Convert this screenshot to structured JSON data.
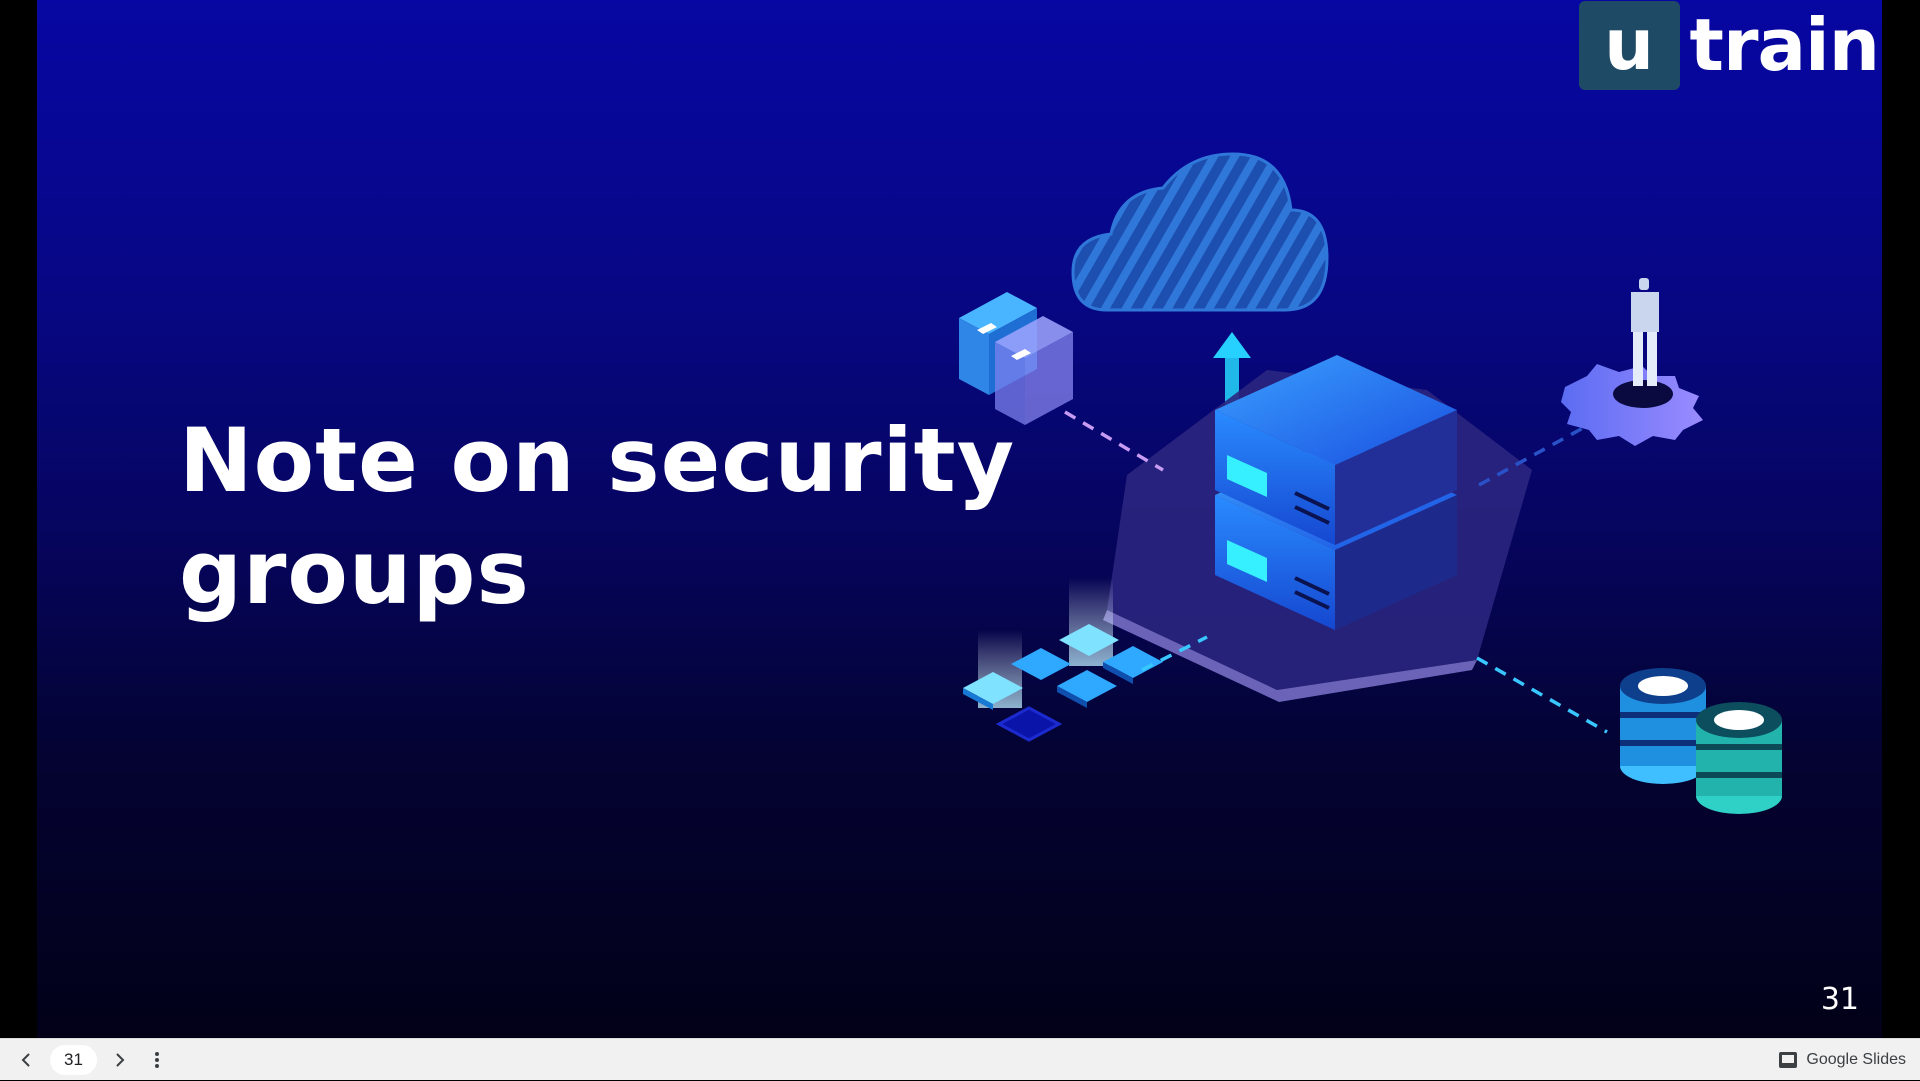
{
  "slide": {
    "title": "Note on security groups",
    "page_number": "31",
    "logo": {
      "box_letter": "u",
      "word": "train"
    }
  },
  "toolbar": {
    "current_page": "31",
    "prev_icon": "chevron-left-icon",
    "next_icon": "chevron-right-icon",
    "menu_icon": "more-vert-icon",
    "brand_label": "Google Slides",
    "brand_icon": "slides-icon"
  },
  "colors": {
    "slide_bg_top": "#0707a3",
    "slide_bg_bottom": "#020118",
    "logo_box": "#1e4a66",
    "accent_cyan": "#2ee6f5",
    "accent_blue": "#2a7dff",
    "accent_purple": "#8a78ff"
  }
}
